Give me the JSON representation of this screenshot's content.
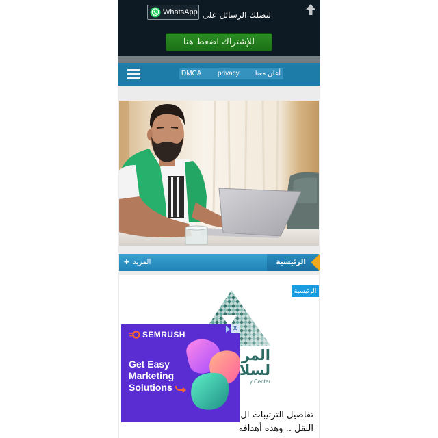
{
  "top_banner": {
    "whatsapp_button": {
      "icon": "whatsapp-icon",
      "label": "WhatsApp"
    },
    "message_text": "لتصلك الرسائل على",
    "subscribe_button": {
      "label": "للإشتراك اضغط هنا"
    },
    "scroll_top_icon": "arrow-up-icon"
  },
  "nav": {
    "menu_icon": "hamburger-icon",
    "links": [
      {
        "label": "DMCA"
      },
      {
        "label": "privacy"
      },
      {
        "label": "أعلن معنا"
      }
    ]
  },
  "category_bar": {
    "more": {
      "icon": "plus-icon",
      "glyph": "+",
      "label": "المزيد"
    },
    "home": {
      "label": "الرئيسية",
      "marker_icon": "diamond-marker-icon"
    }
  },
  "article": {
    "category_badge": "الرئيسية",
    "logo_lettering": [
      "المر",
      "لسلا",
      "y Center"
    ],
    "title_lines": [
      "تفاصيل الترتيبات ال",
      "النقل .. وهذه أهدافه"
    ]
  },
  "ad": {
    "brand_icon": "semrush-flame-icon",
    "brand": "SEMRUSH",
    "headline_lines": [
      "Get Easy",
      "Marketing",
      "Solutions"
    ],
    "cta_icon": "curved-arrow-icon",
    "adchoices_icon": "adchoices-icon",
    "close_glyph": "x"
  },
  "colors": {
    "banner_bg": "#0d1923",
    "nav_blue": "#1d7ca8",
    "subscribe_green": "#1c6f16",
    "whatsapp_green": "#25d366",
    "badge_blue": "#1a9de0",
    "accent_orange": "#f2a81d",
    "ad_purple": "#5a2dd2",
    "semrush_orange": "#ff642d",
    "logo_teal": "#2c6a64"
  }
}
